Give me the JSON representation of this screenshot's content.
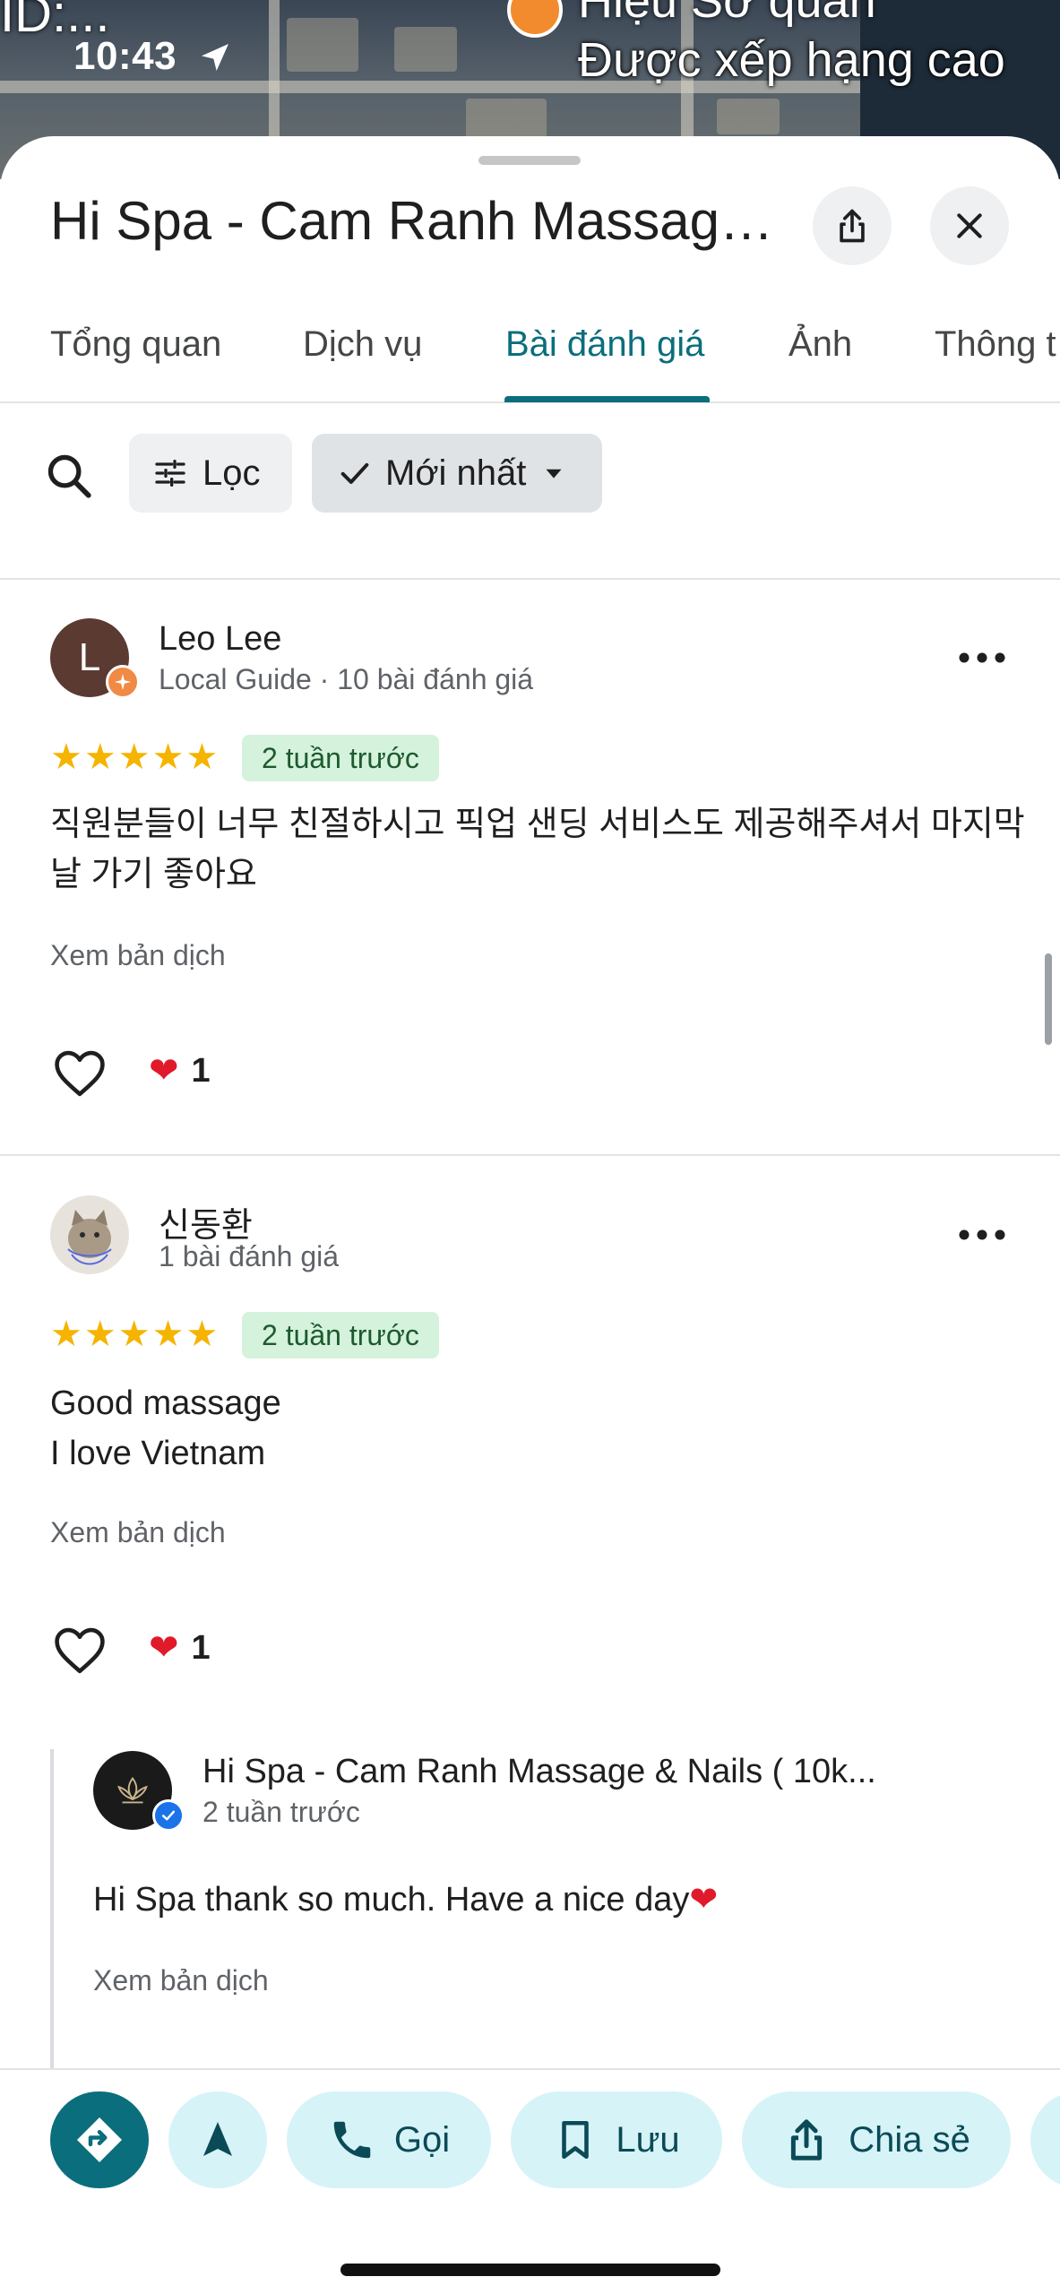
{
  "status_bar": {
    "time": "10:43"
  },
  "map": {
    "top_left_fragment": "ID:...",
    "label_top": "Hiệu Sờ quán",
    "label": "Được xếp hạng cao"
  },
  "place": {
    "title": "Hi Spa - Cam Ranh Massage..."
  },
  "tabs": [
    {
      "label": "Tổng quan"
    },
    {
      "label": "Dịch vụ"
    },
    {
      "label": "Bài đánh giá",
      "active": true
    },
    {
      "label": "Ảnh"
    },
    {
      "label": "Thông t"
    }
  ],
  "filters": {
    "filter_label": "Lọc",
    "sort_label": "Mới nhất"
  },
  "reviews": [
    {
      "avatar_letter": "L",
      "name": "Leo Lee",
      "meta": "Local Guide · 10 bài đánh giá",
      "stars": "★★★★★",
      "time": "2 tuần trước",
      "text_line1": "직원분들이 너무 친절하시고 픽업 샌딩 서비스도 제공해주셔서 마지막",
      "text_line2": "날 가기 좋아요",
      "translate": "Xem bản dịch",
      "likes": "1"
    },
    {
      "name": "신동환",
      "meta": "1 bài đánh giá",
      "stars": "★★★★★",
      "time": "2 tuần trước",
      "text_line1": "Good massage",
      "text_line2": "I love Vietnam",
      "translate": "Xem bản dịch",
      "likes": "1"
    }
  ],
  "owner_reply": {
    "name": "Hi Spa - Cam Ranh Massage & Nails ( 10k...",
    "time": "2 tuần trước",
    "text": "Hi Spa thank so much. Have a nice day",
    "translate": "Xem bản dịch"
  },
  "bottom_actions": {
    "call": "Gọi",
    "save": "Lưu",
    "share": "Chia sẻ"
  },
  "colors": {
    "accent": "#0b6e7d",
    "action_bg": "#d6f3f8",
    "star": "#f5b400",
    "badge_bg": "#d4f2dc",
    "heart": "#e01a2b"
  }
}
